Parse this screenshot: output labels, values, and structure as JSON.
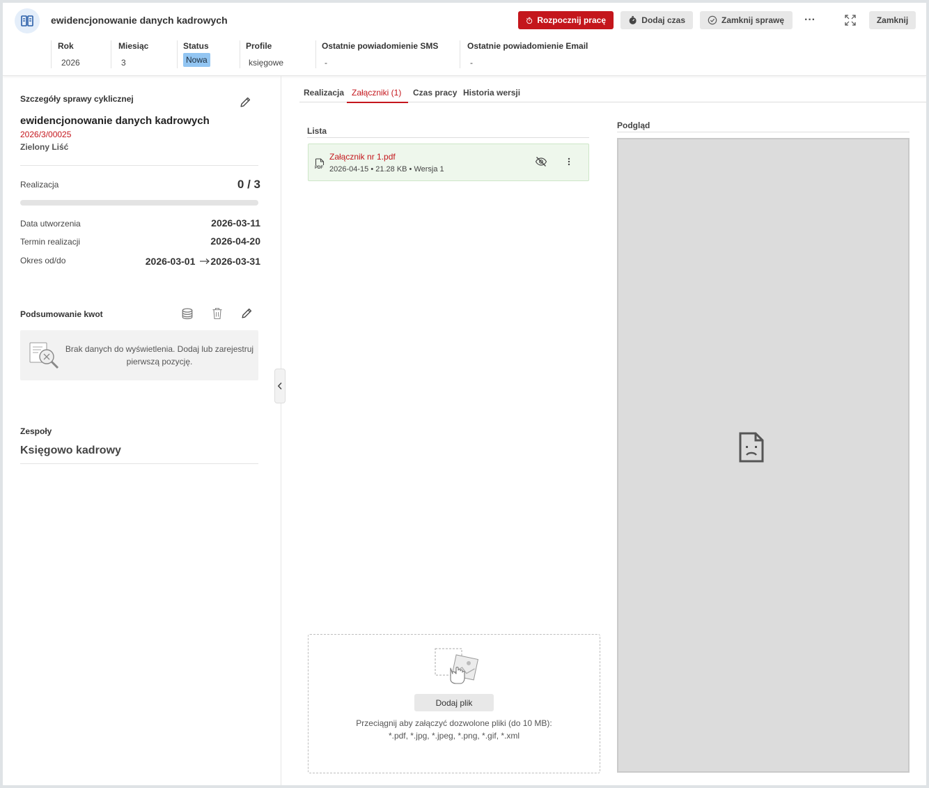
{
  "header": {
    "title": "ewidencjonowanie danych kadrowych",
    "start_work_label": "Rozpocznij pracę",
    "add_time_label": "Dodaj czas",
    "close_case_label": "Zamknij sprawę",
    "more_label": "···",
    "close_label": "Zamknij",
    "accent": "#c4161c"
  },
  "meta": {
    "rok": {
      "label": "Rok",
      "value": "2026"
    },
    "miesiac": {
      "label": "Miesiąc",
      "value": "3"
    },
    "status": {
      "label": "Status",
      "value": "Nowa"
    },
    "profile": {
      "label": "Profile",
      "value": "księgowe"
    },
    "sms": {
      "label": "Ostatnie powiadomienie SMS",
      "value": "-"
    },
    "email": {
      "label": "Ostatnie powiadomienie Email",
      "value": "-"
    }
  },
  "details": {
    "section_title": "Szczegóły sprawy cyklicznej",
    "case_name": "ewidencjonowanie danych kadrowych",
    "case_number": "2026/3/00025",
    "client": "Zielony Liść",
    "realization_label": "Realizacja",
    "realization_value": "0 / 3",
    "progress_fraction": 0,
    "created_label": "Data utworzenia",
    "created_value": "2026-03-11",
    "deadline_label": "Termin realizacji",
    "deadline_value": "2026-04-20",
    "period_label": "Okres od/do",
    "period_from": "2026-03-01",
    "period_to": "2026-03-31"
  },
  "amounts": {
    "title": "Podsumowanie kwot",
    "empty_text": "Brak danych do wyświetlenia. Dodaj lub zarejestruj pierwszą pozycję."
  },
  "teams": {
    "title": "Zespoły",
    "team_name": "Księgowo kadrowy"
  },
  "tabs": [
    {
      "label": "Realizacja"
    },
    {
      "label": "Załączniki (1)"
    },
    {
      "label": "Czas pracy"
    },
    {
      "label": "Historia wersji"
    }
  ],
  "attachments": {
    "list_label": "Lista",
    "preview_label": "Podgląd",
    "items": [
      {
        "name": "Załącznik nr 1.pdf",
        "meta": "2026-04-15 • 21.28 KB • Wersja 1",
        "file_badge": "PDF"
      }
    ],
    "add_file_label": "Dodaj plik",
    "drop_text_1": "Przeciągnij aby załączyć dozwolone pliki (do 10 MB):",
    "drop_text_2": "*.pdf, *.jpg, *.jpeg, *.png, *.gif, *.xml"
  }
}
